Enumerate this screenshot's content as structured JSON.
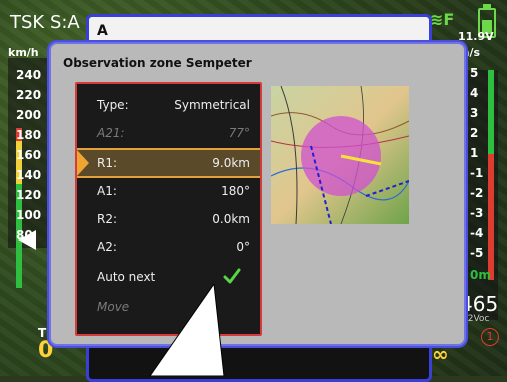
{
  "statusbar": {
    "task_label": "TSK S:A",
    "speed_unit": "km/h",
    "speed_ticks": [
      "240",
      "220",
      "200",
      "180",
      "160",
      "140",
      "120",
      "100",
      "80"
    ],
    "vario_top": "11.9V",
    "vario_unit": "m/s",
    "vario_ticks": [
      "5",
      "4",
      "3",
      "2",
      "1",
      "-1",
      "-2",
      "-3",
      "-4",
      "-5"
    ],
    "vario_zero": "0m",
    "altitude_big": "465",
    "altitude_sub": "92Voc",
    "circle_num": "1",
    "bottom_left_num": "0",
    "bottom_left_t": "T",
    "infinity": "∞",
    "gps_icon": "gps-icon"
  },
  "top_tab": {
    "label": "A"
  },
  "dialog": {
    "title": "Observation zone Sempeter",
    "rows": [
      {
        "label": "Type:",
        "value": "Symmetrical",
        "disabled": false
      },
      {
        "label": "A21:",
        "value": "77°",
        "disabled": true
      },
      {
        "label": "R1:",
        "value": "9.0km",
        "disabled": false,
        "selected": true
      },
      {
        "label": "A1:",
        "value": "180°",
        "disabled": false
      },
      {
        "label": "R2:",
        "value": "0.0km",
        "disabled": false
      },
      {
        "label": "A2:",
        "value": "0°",
        "disabled": false
      },
      {
        "label": "Auto next",
        "value": "",
        "disabled": false,
        "check": true
      },
      {
        "label": "Move",
        "value": "",
        "disabled": true
      }
    ]
  },
  "colors": {
    "accent_blue": "#3a3fd6",
    "selection_orange": "#f0a531",
    "zone_magenta": "#d050d0"
  }
}
